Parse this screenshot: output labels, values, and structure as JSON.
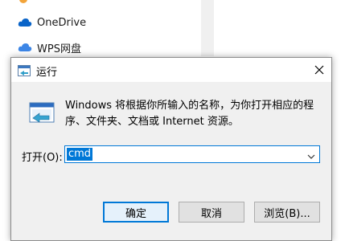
{
  "background": {
    "nav_items": [
      {
        "label": "OneDrive",
        "icon": "onedrive-cloud-icon"
      },
      {
        "label": "WPS网盘",
        "icon": "wps-cloud-icon"
      }
    ]
  },
  "dialog": {
    "title": "运行",
    "description": "Windows 将根据你所输入的名称，为你打开相应的程序、文件夹、文档或 Internet 资源。",
    "open_label": "打开(O):",
    "open_value": "cmd",
    "buttons": {
      "ok": "确定",
      "cancel": "取消",
      "browse": "浏览(B)..."
    }
  },
  "colors": {
    "accent": "#0078d7",
    "dialog_bg": "#f0f0f0"
  }
}
